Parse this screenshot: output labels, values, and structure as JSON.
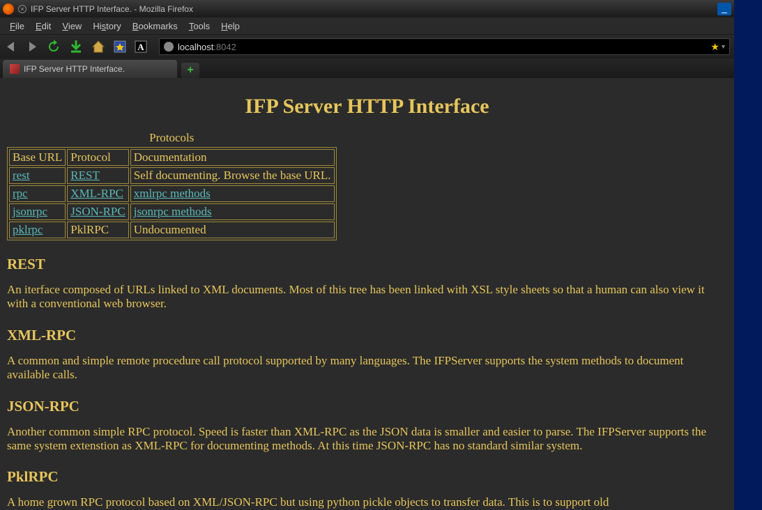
{
  "window": {
    "title": "IFP Server HTTP Interface. - Mozilla Firefox"
  },
  "menubar": {
    "file": "File",
    "edit": "Edit",
    "view": "View",
    "history": "History",
    "bookmarks": "Bookmarks",
    "tools": "Tools",
    "help": "Help"
  },
  "urlbar": {
    "host": "localhost",
    "port": ":8042"
  },
  "tab": {
    "label": "IFP Server HTTP Interface."
  },
  "page": {
    "title": "IFP Server HTTP Interface",
    "table": {
      "caption": "Protocols",
      "headers": {
        "base": "Base URL",
        "protocol": "Protocol",
        "doc": "Documentation"
      },
      "rows": [
        {
          "base": "rest",
          "protocol": "REST",
          "doc": "Self documenting. Browse the base URL.",
          "doc_link": false
        },
        {
          "base": "rpc",
          "protocol": "XML-RPC",
          "doc": "xmlrpc methods",
          "doc_link": true
        },
        {
          "base": "jsonrpc",
          "protocol": "JSON-RPC",
          "doc": "jsonrpc methods",
          "doc_link": true
        },
        {
          "base": "pklrpc",
          "protocol": "PklRPC",
          "doc": "Undocumented",
          "doc_link": false,
          "protocol_link": false
        }
      ]
    },
    "sections": [
      {
        "heading": "REST",
        "body": "An iterface composed of URLs linked to XML documents. Most of this tree has been linked with XSL style sheets so that a human can also view it with a conventional web browser."
      },
      {
        "heading": "XML-RPC",
        "body": "A common and simple remote procedure call protocol supported by many languages. The IFPServer supports the system methods to document available calls."
      },
      {
        "heading": "JSON-RPC",
        "body": "Another common simple RPC protocol. Speed is faster than XML-RPC as the JSON data is smaller and easier to parse. The IFPServer supports the same system extenstion as XML-RPC for documenting methods. At this time JSON-RPC has no standard similar system."
      },
      {
        "heading": "PklRPC",
        "body": "A home grown RPC protocol based on XML/JSON-RPC but using python pickle objects to transfer data. This is to support old"
      }
    ]
  }
}
